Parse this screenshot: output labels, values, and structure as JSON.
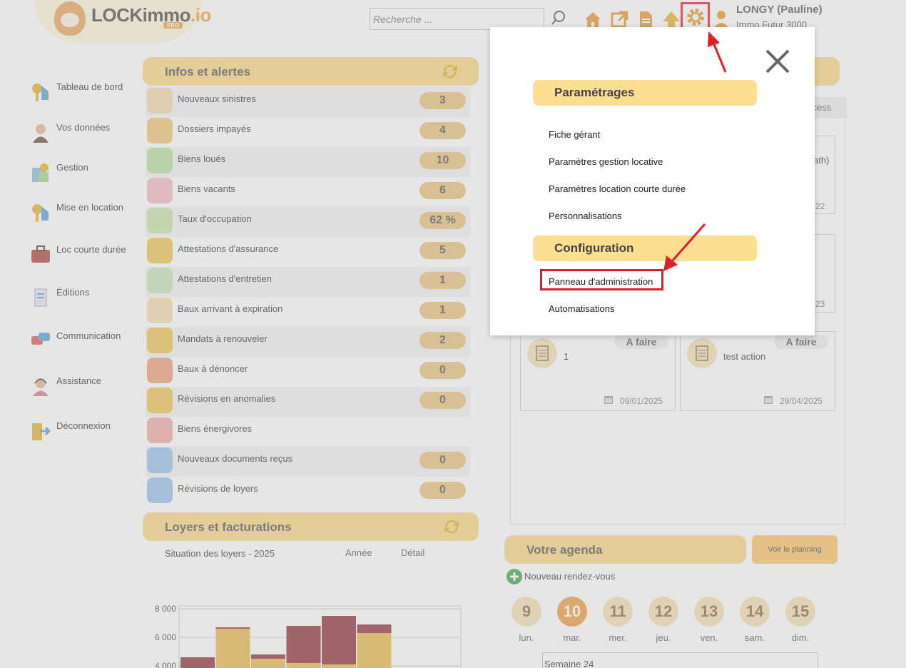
{
  "header": {
    "logo_main": "LOCKimmo",
    "logo_suffix": ".io",
    "logo_pro": "PRO",
    "search_placeholder": "Recherche ...",
    "user_name": "LONGY (Pauline)",
    "user_org": "Immo Futur 3000"
  },
  "sidebar": {
    "items": [
      {
        "label": "Tableau de bord",
        "icon": "keys-icon"
      },
      {
        "label": "Vos données",
        "icon": "user-icon"
      },
      {
        "label": "Gestion",
        "icon": "gestion-icon"
      },
      {
        "label": "Mise en location",
        "icon": "keys-icon"
      },
      {
        "label": "Loc courte durée",
        "icon": "suitcase-icon"
      },
      {
        "label": "Éditions",
        "icon": "document-icon"
      },
      {
        "label": "Communication",
        "icon": "chat-icon"
      },
      {
        "label": "Assistance",
        "icon": "support-icon"
      },
      {
        "label": "Déconnexion",
        "icon": "logout-icon"
      }
    ]
  },
  "infos": {
    "title": "Infos et alertes",
    "rows": [
      {
        "label": "Nouveaux sinistres",
        "value": "3",
        "color": "#f3d7a8"
      },
      {
        "label": "Dossiers impayés",
        "value": "4",
        "color": "#f1c774"
      },
      {
        "label": "Biens loués",
        "value": "10",
        "color": "#b9dfa0"
      },
      {
        "label": "Biens vacants",
        "value": "6",
        "color": "#f2b9c4"
      },
      {
        "label": "Taux d'occupation",
        "value": "62 %",
        "color": "#c9e3a5"
      },
      {
        "label": "Attestations d'assurance",
        "value": "5",
        "color": "#f1c350"
      },
      {
        "label": "Attestations d'entretien",
        "value": "1",
        "color": "#c7e6b7"
      },
      {
        "label": "Baux arrivant à expiration",
        "value": "1",
        "color": "#f3dba8"
      },
      {
        "label": "Mandats à renouveler",
        "value": "2",
        "color": "#f1c350"
      },
      {
        "label": "Baux à dénoncer",
        "value": "0",
        "color": "#ee9f74"
      },
      {
        "label": "Révisions en anomalies",
        "value": "0",
        "color": "#f1c350"
      },
      {
        "label": "Biens énergivores",
        "value": "",
        "color": "#f2a9a9"
      },
      {
        "label": "Nouveaux documents reçus",
        "value": "0",
        "color": "#96c1ea"
      },
      {
        "label": "Révisions de loyers",
        "value": "0",
        "color": "#96c1ea"
      }
    ]
  },
  "loyers": {
    "title": "Loyers et facturations",
    "subtitle": "Situation des loyers - 2025",
    "tab_annee": "Année",
    "tab_detail": "Détail"
  },
  "chart_data": {
    "type": "bar",
    "title": "Situation des loyers - 2025",
    "ytick_labels": [
      "8 000",
      "6 000",
      "4 000"
    ],
    "ylim": [
      3800,
      8300
    ],
    "series": [
      {
        "values": [
          4600,
          6700,
          4800,
          6800,
          7500,
          6900
        ],
        "color": "#8e2f38"
      },
      {
        "values": [
          3600,
          6600,
          4500,
          4200,
          4100,
          6300
        ],
        "color": "#e8b94a"
      }
    ]
  },
  "tasks": {
    "cards": [
      {
        "status": "A faire",
        "text": "1",
        "date": "09/01/2025"
      },
      {
        "status": "A faire",
        "text": "test action",
        "date": "29/04/2025"
      }
    ],
    "partial_texts": [
      "rocess",
      "ath)",
      "22",
      "23"
    ]
  },
  "agenda": {
    "title": "Votre agenda",
    "planning_button": "Voir le planning",
    "new_appointment": "Nouveau rendez-vous",
    "days": [
      {
        "num": "9",
        "label": "lun."
      },
      {
        "num": "10",
        "label": "mar.",
        "today": true
      },
      {
        "num": "11",
        "label": "mer."
      },
      {
        "num": "12",
        "label": "jeu."
      },
      {
        "num": "13",
        "label": "ven."
      },
      {
        "num": "14",
        "label": "sam."
      },
      {
        "num": "15",
        "label": "dim."
      }
    ],
    "week": "Semaine 24"
  },
  "modal": {
    "section1": "Paramétrages",
    "links1": [
      "Fiche gérant",
      "Paramètres gestion locative",
      "Paramètres location courte durée",
      "Personnalisations"
    ],
    "section2": "Configuration",
    "links2": [
      "Panneau d'administration",
      "Automatisations"
    ]
  },
  "colors": {
    "accent": "#fbd985",
    "highlight": "#d8202a",
    "orange": "#ec9a3f"
  }
}
